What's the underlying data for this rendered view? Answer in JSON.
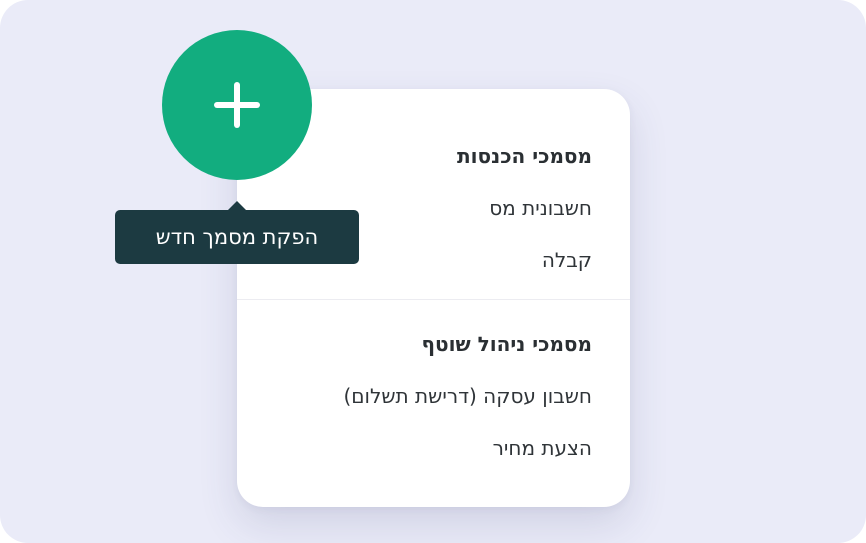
{
  "fab": {
    "icon": "plus-icon",
    "color": "#12ad7f"
  },
  "tooltip": {
    "text": "הפקת מסמך חדש",
    "background": "#1c3a41"
  },
  "menu": {
    "income_group": {
      "heading": "מסמכי הכנסות",
      "items": [
        "חשבונית מס",
        "קבלה"
      ]
    },
    "management_group": {
      "heading": "מסמכי ניהול שוטף",
      "items": [
        "חשבון עסקה (דרישת תשלום)",
        "הצעת מחיר"
      ]
    }
  },
  "colors": {
    "background": "#eaebf8",
    "card": "#ffffff",
    "text": "#2a2f33"
  }
}
